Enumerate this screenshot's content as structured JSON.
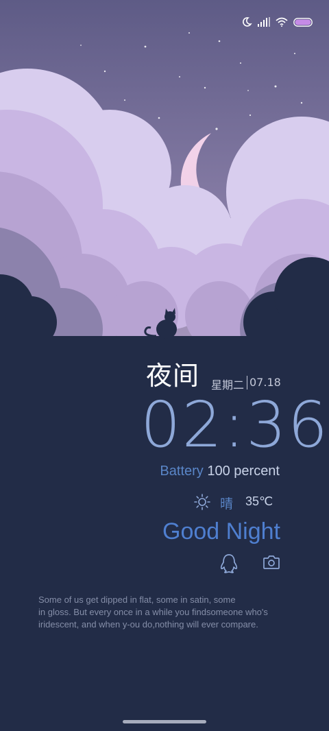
{
  "colors": {
    "background": "#222c47",
    "sky_top": "#5e5b86",
    "sky_bottom": "#9a8fb2",
    "moon": "#f2d6e6",
    "accent_blue": "#5a86c8",
    "clock": "#8ea8d8",
    "greeting": "#4f7fd0"
  },
  "status_bar": {
    "icons": [
      "moon-icon",
      "signal-icon",
      "wifi-icon",
      "battery-icon"
    ]
  },
  "header": {
    "title": "夜间",
    "weekday": "星期二",
    "date": "07.18"
  },
  "clock": {
    "time": "02:36"
  },
  "battery": {
    "label": "Battery",
    "value": "100",
    "unit": "percent",
    "level": 1.0
  },
  "weather": {
    "icon": "sun-icon",
    "condition": "晴",
    "temperature": "35℃"
  },
  "greeting": "Good Night",
  "shortcuts": [
    {
      "icon": "qq-penguin-icon"
    },
    {
      "icon": "camera-icon"
    }
  ],
  "quote": {
    "lines": [
      "Some of us get dipped in flat, some in satin, some",
      "in gloss. But every once in a while you findsomeone who's",
      "iridescent, and when y-ou do,nothing will ever compare."
    ]
  }
}
